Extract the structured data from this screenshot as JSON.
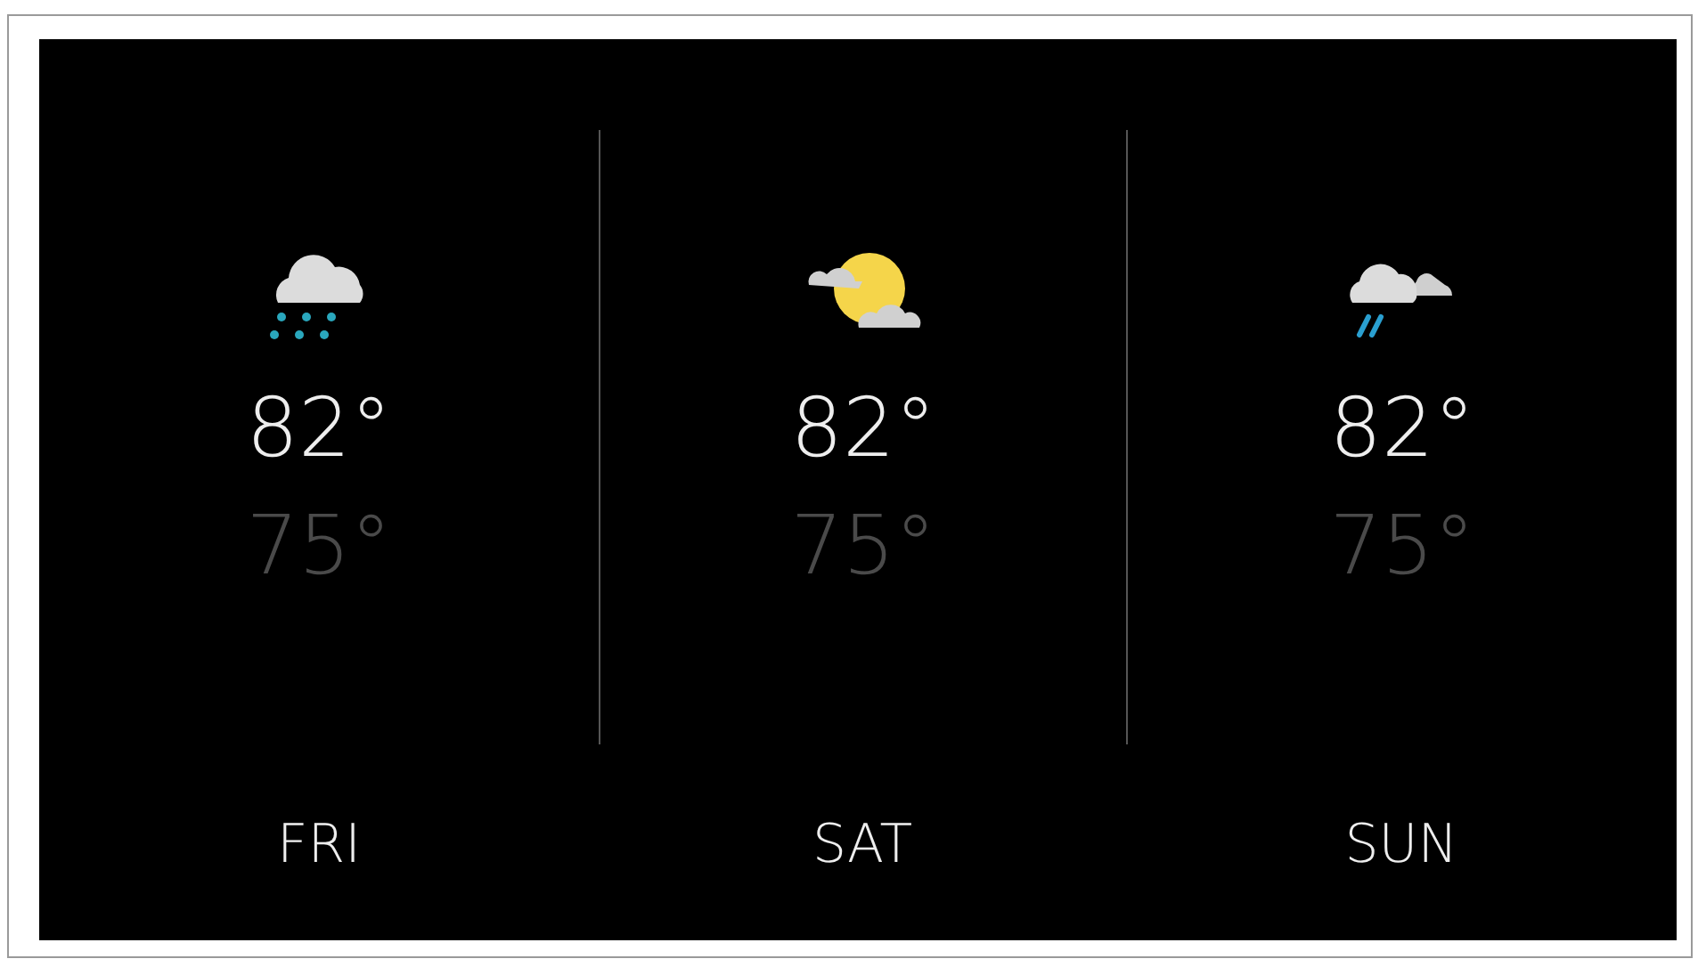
{
  "days": [
    {
      "kind": "snow",
      "high": "82°",
      "low": "75°",
      "label": "FRI"
    },
    {
      "kind": "partly-sunny",
      "high": "82°",
      "low": "75°",
      "label": "SAT"
    },
    {
      "kind": "rain",
      "high": "82°",
      "low": "75°",
      "label": "SUN"
    }
  ]
}
